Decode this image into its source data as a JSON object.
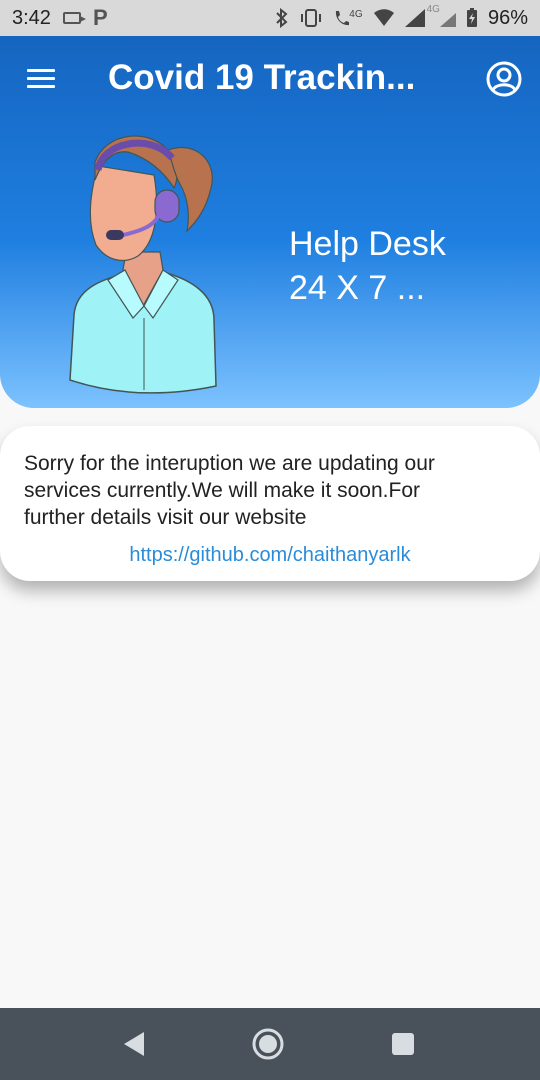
{
  "status_bar": {
    "time": "3:42",
    "network_labels": [
      "4G",
      "4G"
    ],
    "battery_percent": "96%"
  },
  "header": {
    "title": "Covid 19 Trackin...",
    "help_line1": "Help Desk",
    "help_line2": "24 X 7 ..."
  },
  "info_card": {
    "message": "Sorry for the interuption we are updating our services currently.We will make it soon.For further details visit our website",
    "link": "https://github.com/chaithanyarlk"
  },
  "colors": {
    "header_top": "#1565c0",
    "header_bottom": "#7cc2ff",
    "link": "#2a8cd8",
    "nav_bar": "#49515a"
  },
  "icons": [
    "menu-icon",
    "account-circle-icon",
    "back-icon",
    "home-icon",
    "recents-icon"
  ]
}
